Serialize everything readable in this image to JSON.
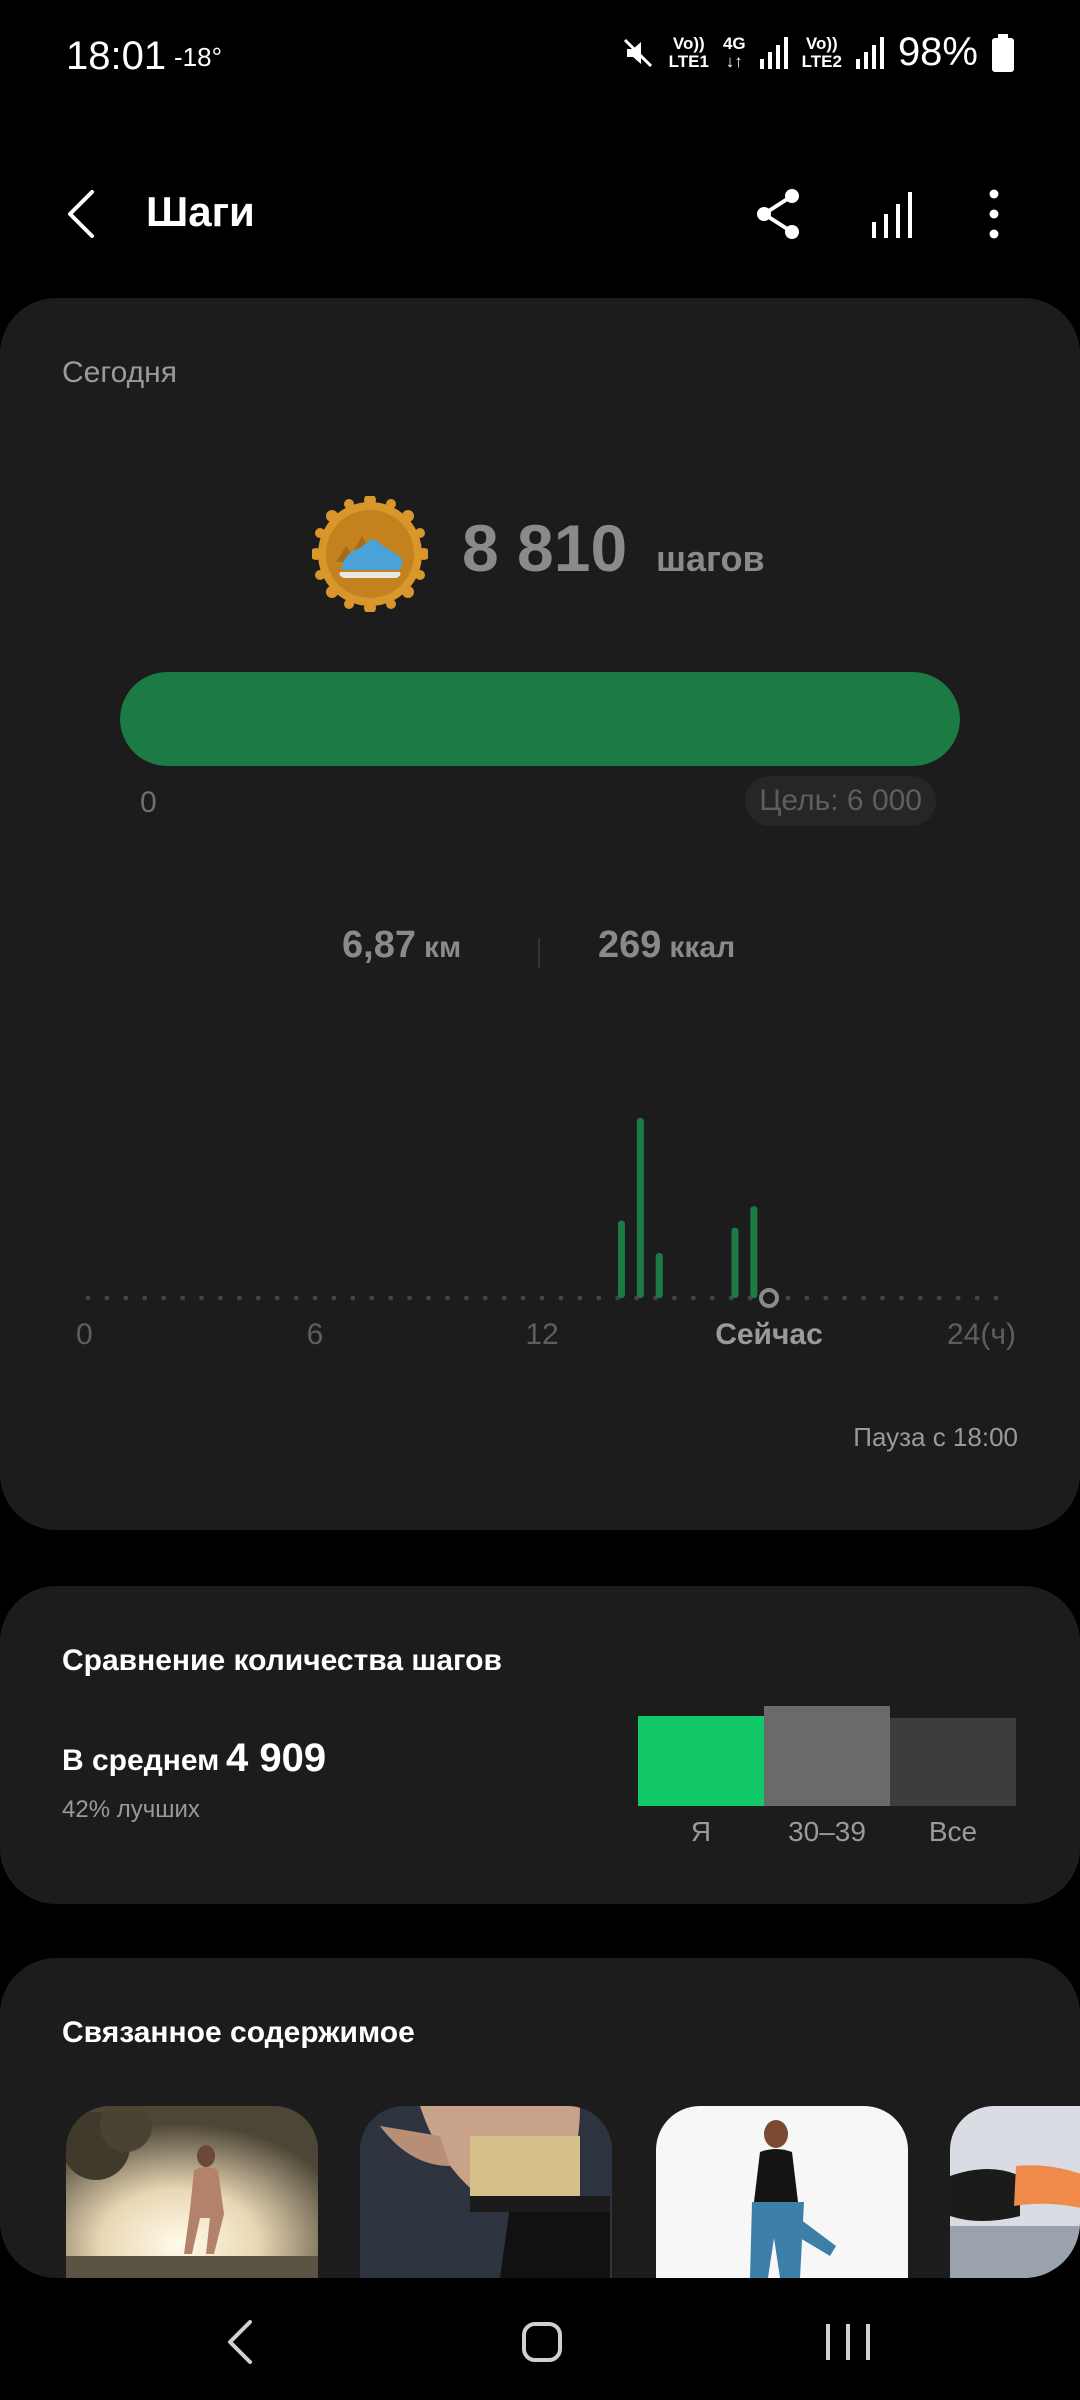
{
  "status_bar": {
    "time": "18:01",
    "temperature": "-18°",
    "sim1_top": "Vo))",
    "sim1_bottom": "LTE1",
    "net_top": "4G",
    "net_bottom": "↓↑",
    "sim2_top": "Vo))",
    "sim2_bottom": "LTE2",
    "battery": "98%"
  },
  "header": {
    "title": "Шаги",
    "icons": [
      "back-arrow-icon",
      "share-icon",
      "bar-chart-icon",
      "more-vertical-icon"
    ]
  },
  "today": {
    "label": "Сегодня",
    "steps": "8 810",
    "steps_unit": "шагов",
    "progress_fraction": 1.0,
    "progress_min": "0",
    "goal": "Цель: 6 000",
    "distance": "6,87",
    "distance_unit": "км",
    "calories": "269",
    "calories_unit": "ккал",
    "pause": "Пауза с 18:00",
    "colors": {
      "progress": "#1c7a45",
      "chart_bar": "#1c7a45"
    }
  },
  "chart_data": {
    "type": "bar",
    "x_tick_labels": [
      "0",
      "6",
      "12",
      "Сейчас",
      "24(ч)"
    ],
    "x_ticks": [
      0,
      6,
      12,
      18,
      24
    ],
    "xlim": [
      0,
      24
    ],
    "now_hour": 18,
    "bars": [
      {
        "x": 14.1,
        "y": 0.43
      },
      {
        "x": 14.6,
        "y": 1.0
      },
      {
        "x": 15.1,
        "y": 0.25
      },
      {
        "x": 17.1,
        "y": 0.39
      },
      {
        "x": 17.6,
        "y": 0.51
      }
    ],
    "ylim": [
      0,
      1
    ],
    "grid": "dotted baseline"
  },
  "compare": {
    "title": "Сравнение количества шагов",
    "avg_label": "В среднем",
    "avg_value": "4 909",
    "better": "42% лучших",
    "bars": [
      {
        "label": "Я",
        "value": 0.9,
        "color": "#12c96a"
      },
      {
        "label": "30–39",
        "value": 1.0,
        "color": "#6a6a6a"
      },
      {
        "label": "Все",
        "value": 0.88,
        "color": "#3d3d3d"
      }
    ]
  },
  "related": {
    "title": "Связанное содержимое",
    "thumbs": [
      "running-photo",
      "back-exercise-photo",
      "stretching-photo",
      "plank-photo"
    ]
  },
  "nav": {
    "icons": [
      "nav-back-icon",
      "nav-home-icon",
      "nav-recents-icon"
    ]
  }
}
